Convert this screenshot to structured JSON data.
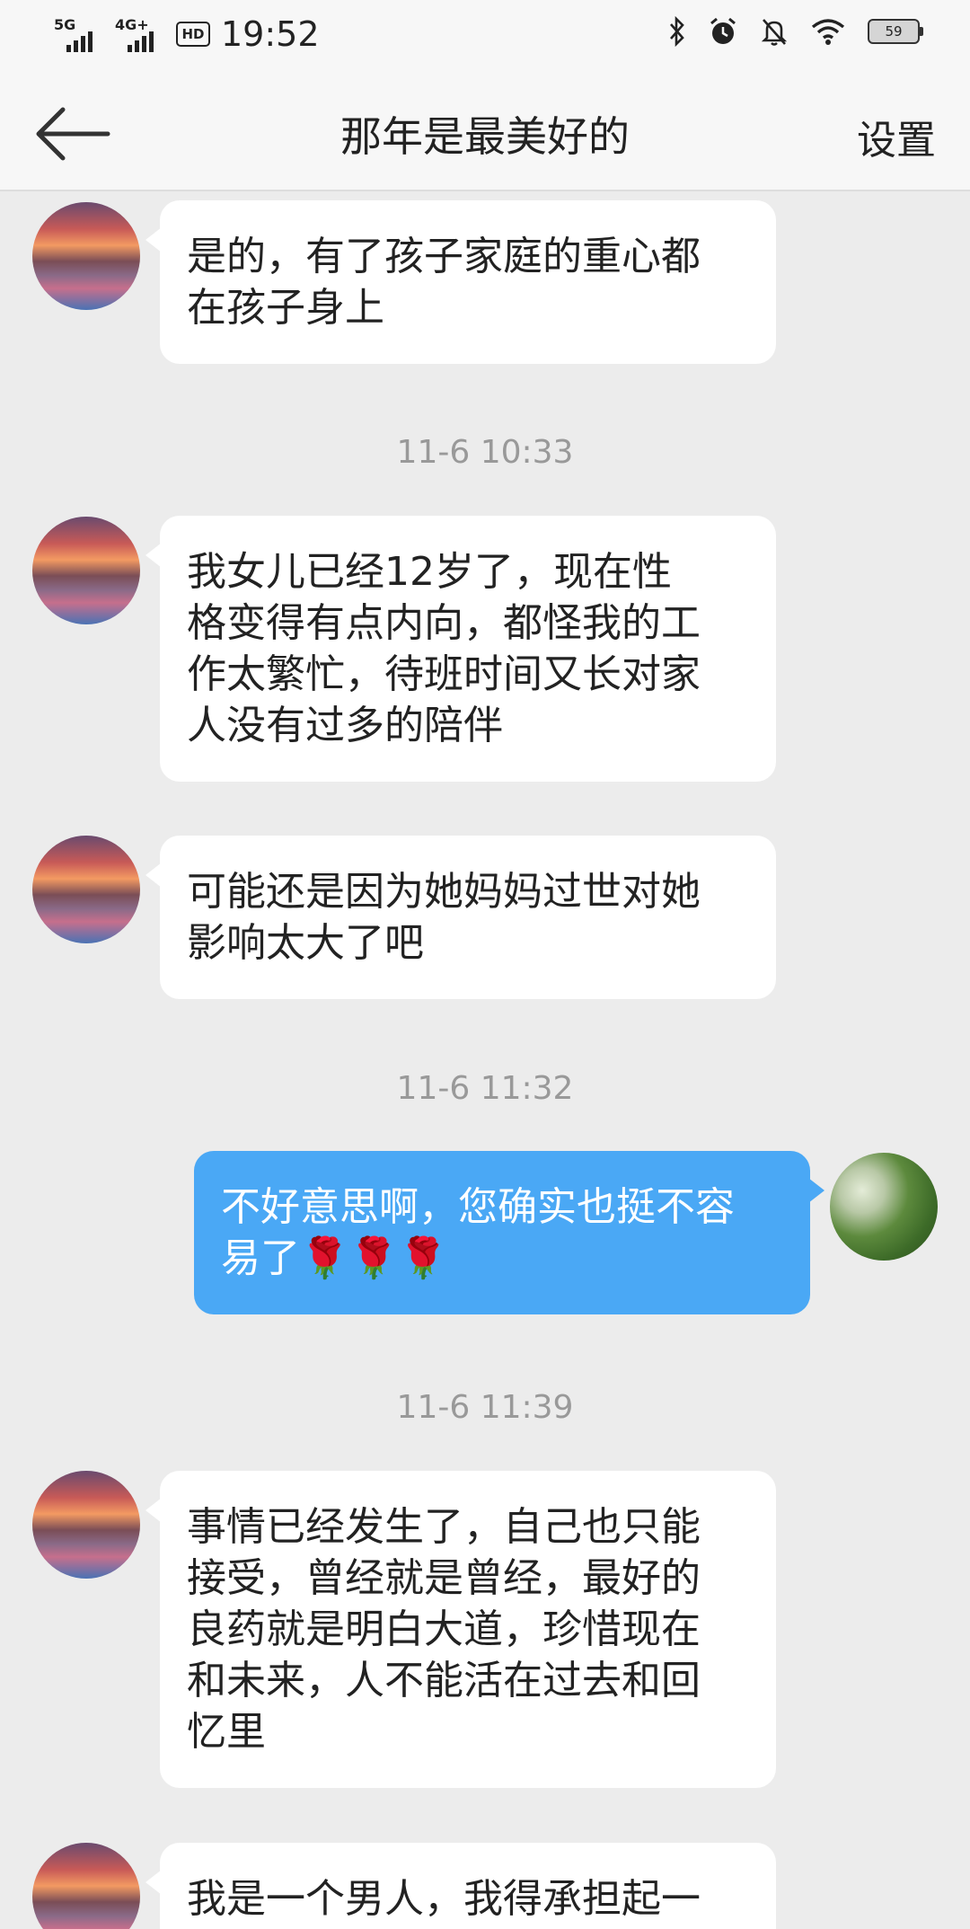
{
  "status": {
    "time": "19:52",
    "network1": "5G",
    "network2": "4G+",
    "hd": "HD",
    "battery": "59"
  },
  "nav": {
    "title": "那年是最美好的",
    "settings": "设置"
  },
  "chat": {
    "messages": [
      {
        "text": "是的，有了孩子家庭的重心都\n在孩子身上"
      },
      {
        "text": "我女儿已经12岁了，现在性\n格变得有点内向，都怪我的工\n作太繁忙，待班时间又长对家\n人没有过多的陪伴"
      },
      {
        "text": "可能还是因为她妈妈过世对她\n影响太大了吧"
      },
      {
        "text": "不好意思啊，您确实也挺不容\n易了🌹🌹🌹"
      },
      {
        "text": "事情已经发生了，自己也只能\n接受，曾经就是曾经，最好的\n良药就是明白大道，珍惜现在\n和未来，人不能活在过去和回\n忆里"
      },
      {
        "text": "我是一个男人，我得承担起一"
      }
    ],
    "timestamps": [
      "11-6 10:33",
      "11-6 11:32",
      "11-6 11:39"
    ]
  }
}
